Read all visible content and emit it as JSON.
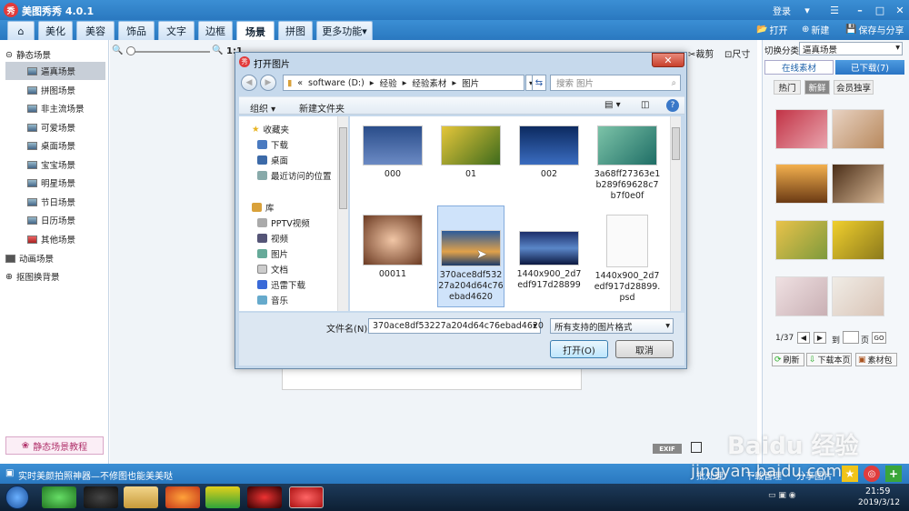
{
  "titlebar": {
    "logo": "秀",
    "title": "美图秀秀 4.0.1",
    "login": "登录"
  },
  "menu": {
    "tabs": [
      "美化",
      "美容",
      "饰品",
      "文字",
      "边框",
      "场景",
      "拼图",
      "更多功能"
    ],
    "active": "场景",
    "open": "打开",
    "new": "新建",
    "save": "保存与分享"
  },
  "left": {
    "static_group": "静态场景",
    "items": [
      "逼真场景",
      "拼图场景",
      "非主流场景",
      "可爱场景",
      "桌面场景",
      "宝宝场景",
      "明星场景",
      "节日场景",
      "日历场景",
      "其他场景"
    ],
    "anim_group": "动画场景",
    "cutout_group": "抠图换背景",
    "tutorial": "静态场景教程"
  },
  "center": {
    "zoom_label": "1:1",
    "tool_crop": "裁剪",
    "tool_size": "尺寸"
  },
  "right": {
    "category_label": "切换分类",
    "category_value": "逼真场景",
    "tabs": [
      "在线素材",
      "已下载(7)"
    ],
    "subtabs": [
      "热门",
      "新鲜",
      "会员独享"
    ],
    "page": "1/37",
    "goto": "到",
    "page_unit": "页",
    "go": "GO",
    "refresh": "刷新",
    "download_page": "下载本页",
    "pack": "素材包"
  },
  "status": {
    "text": "实时美颜拍照神器—不修图也能美美哒",
    "batch": "批处理",
    "download_mgr": "下载管理",
    "share": "分享图片",
    "exif": "EXIF"
  },
  "taskbar": {
    "time": "21:59",
    "date": "2019/3/12"
  },
  "watermark": {
    "brand": "Baidu 经验",
    "url": "jingyan.baidu.com"
  },
  "dialog": {
    "title": "打开图片",
    "path": [
      "software (D:)",
      "经验",
      "经验素材",
      "图片"
    ],
    "path_prefix": "«",
    "search_placeholder": "搜索 图片",
    "organize": "组织",
    "new_folder": "新建文件夹",
    "nav": {
      "favorites": "收藏夹",
      "fav_items": [
        "下载",
        "桌面",
        "最近访问的位置"
      ],
      "library": "库",
      "lib_items": [
        "PPTV视频",
        "视频",
        "图片",
        "文档",
        "迅雷下载",
        "音乐"
      ]
    },
    "files": [
      {
        "name": "000"
      },
      {
        "name": "01"
      },
      {
        "name": "002"
      },
      {
        "name": "3a68ff27363e1b289f69628c7b7f0e0f"
      },
      {
        "name": "00011"
      },
      {
        "name": "370ace8df53227a204d64c76ebad4620"
      },
      {
        "name": "1440x900_2d7edf917d28899"
      },
      {
        "name": "1440x900_2d7edf917d28899.psd"
      }
    ],
    "selected_file": "370ace8df53227a204d64c76ebad4620",
    "filename_label": "文件名(N):",
    "filename_value": "370ace8df53227a204d64c76ebad4620",
    "filter_value": "所有支持的图片格式",
    "open_button": "打开(O)",
    "cancel_button": "取消"
  }
}
